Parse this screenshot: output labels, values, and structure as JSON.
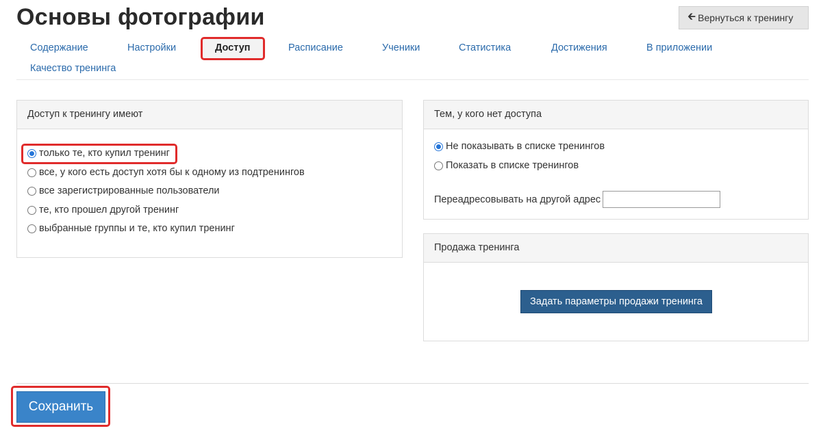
{
  "header": {
    "title": "Основы фотографии",
    "back_button": "Вернуться к тренингу"
  },
  "tabs": [
    {
      "label": "Содержание"
    },
    {
      "label": "Настройки"
    },
    {
      "label": "Доступ",
      "active": true
    },
    {
      "label": "Расписание"
    },
    {
      "label": "Ученики"
    },
    {
      "label": "Статистика"
    },
    {
      "label": "Достижения"
    },
    {
      "label": "В приложении"
    },
    {
      "label": "Качество тренинга"
    }
  ],
  "access_panel": {
    "title": "Доступ к тренингу имеют",
    "options": [
      {
        "label": "только те, кто купил тренинг",
        "checked": true
      },
      {
        "label": "все, у кого есть доступ хотя бы к одному из подтренингов",
        "checked": false
      },
      {
        "label": "все зарегистрированные пользователи",
        "checked": false
      },
      {
        "label": "те, кто прошел другой тренинг",
        "checked": false
      },
      {
        "label": "выбранные группы и те, кто купил тренинг",
        "checked": false
      }
    ]
  },
  "no_access_panel": {
    "title": "Тем, у кого нет доступа",
    "options": [
      {
        "label": "Не показывать в списке тренингов",
        "checked": true
      },
      {
        "label": "Показать в списке тренингов",
        "checked": false
      }
    ],
    "redirect_label": "Переадресовывать на другой адрес",
    "redirect_value": ""
  },
  "sale_panel": {
    "title": "Продажа тренинга",
    "button": "Задать параметры продажи тренинга"
  },
  "footer": {
    "save_button": "Сохранить"
  },
  "colors": {
    "link": "#2a6aab",
    "highlight": "#e02b2b",
    "save_button": "#3a84c9",
    "sale_button": "#2c5f8e"
  },
  "icons": {
    "back": "arrow-left-icon"
  }
}
